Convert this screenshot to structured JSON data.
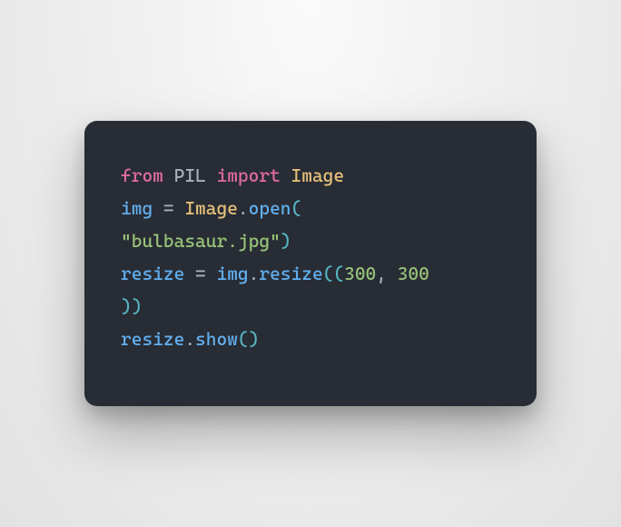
{
  "code": {
    "line1": {
      "from": "from",
      "module": "PIL",
      "import": "import",
      "class": "Image"
    },
    "line2": {
      "var": "img",
      "eq": " = ",
      "class": "Image",
      "dot": ".",
      "func": "open",
      "lparen": "("
    },
    "line3": {
      "string": "\"bulbasaur.jpg\"",
      "rparen": ")"
    },
    "line4": {
      "var": "resize",
      "eq": " = ",
      "obj": "img",
      "dot": ".",
      "func": "resize",
      "lparen": "(",
      "lparen2": "(",
      "num1": "300",
      "comma": ", ",
      "num2": "300"
    },
    "line5": {
      "rparen2": ")",
      "rparen": ")"
    },
    "line6": {
      "obj": "resize",
      "dot": ".",
      "func": "show",
      "lparen": "(",
      "rparen": ")"
    }
  },
  "colors": {
    "background": "#282c34",
    "keyword": "#e06c9f",
    "plain": "#abb2bf",
    "class": "#e5c07b",
    "func": "#61afef",
    "string": "#98c379",
    "number": "#98c379",
    "brace": "#56b6c2"
  }
}
